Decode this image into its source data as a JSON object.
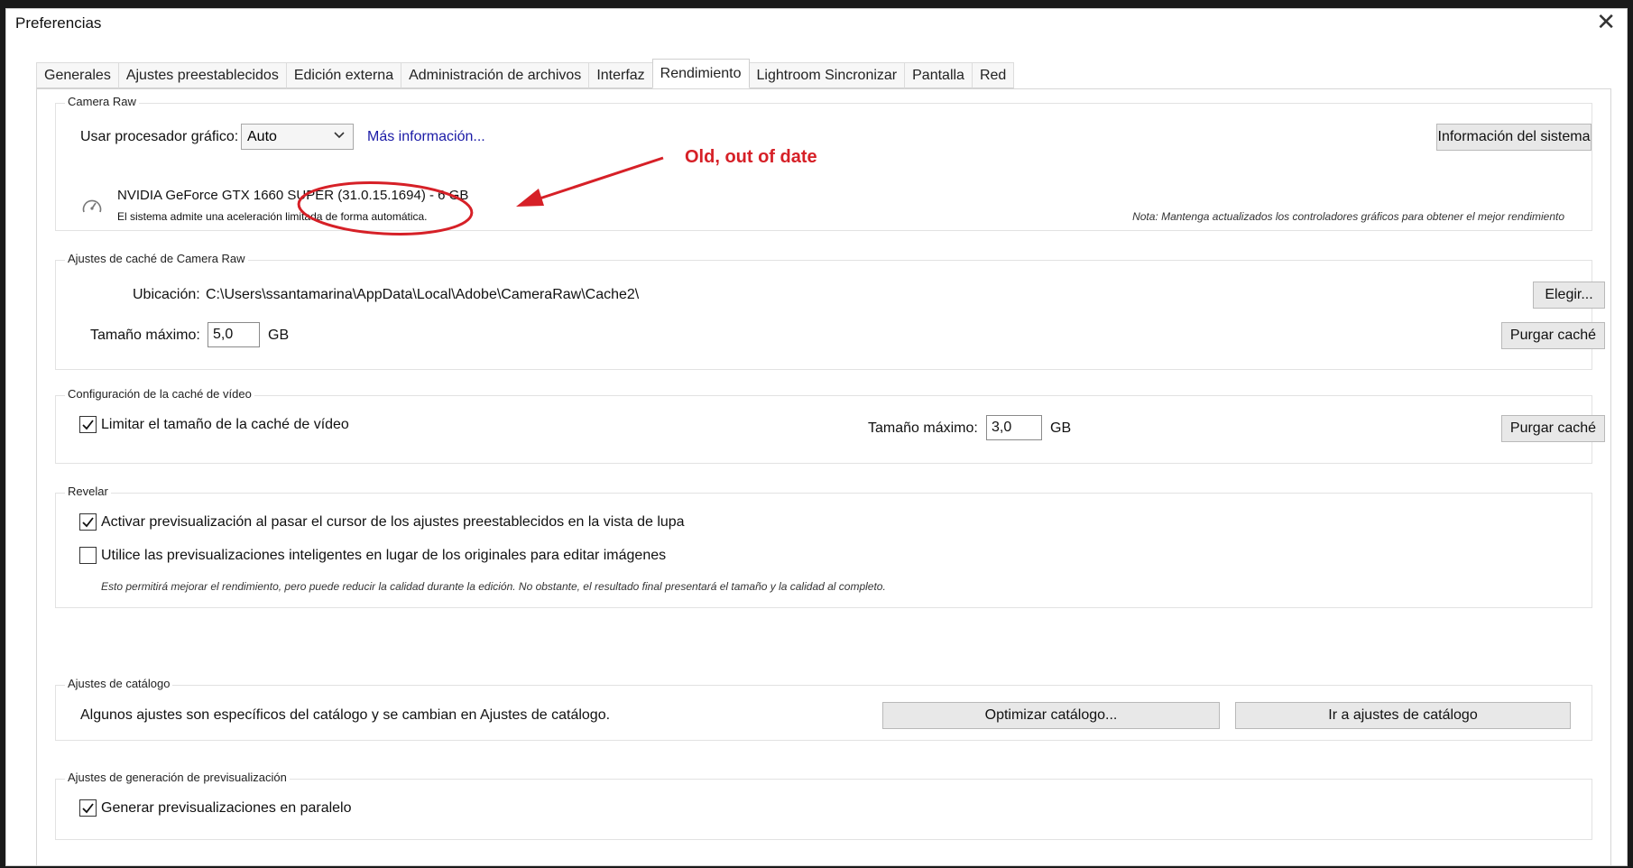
{
  "window": {
    "title": "Preferencias"
  },
  "tabs": [
    {
      "label": "Generales"
    },
    {
      "label": "Ajustes preestablecidos"
    },
    {
      "label": "Edición externa"
    },
    {
      "label": "Administración de archivos"
    },
    {
      "label": "Interfaz"
    },
    {
      "label": "Rendimiento"
    },
    {
      "label": "Lightroom Sincronizar"
    },
    {
      "label": "Pantalla"
    },
    {
      "label": "Red"
    }
  ],
  "active_tab": "Rendimiento",
  "camera_raw": {
    "group_label": "Camera Raw",
    "gpu_label": "Usar procesador gráfico:",
    "gpu_value": "Auto",
    "more_info": "Más información...",
    "system_info_button": "Información del sistema",
    "gpu_name": "NVIDIA GeForce GTX 1660 SUPER (31.0.15.1694) - 6 GB",
    "gpu_support": "El sistema admite una aceleración limitada de forma automática.",
    "note": "Nota: Mantenga actualizados los controladores gráficos para obtener el mejor rendimiento"
  },
  "annotation": {
    "text": "Old, out of date",
    "color": "#d62027"
  },
  "cache": {
    "group_label": "Ajustes de caché de Camera Raw",
    "location_label": "Ubicación:",
    "location_value": "C:\\Users\\ssantamarina\\AppData\\Local\\Adobe\\CameraRaw\\Cache2\\",
    "choose_button": "Elegir...",
    "max_size_label": "Tamaño máximo:",
    "max_size_value": "5,0",
    "unit": "GB",
    "purge_button": "Purgar caché"
  },
  "video_cache": {
    "group_label": "Configuración de la caché de vídeo",
    "limit_label": "Limitar el tamaño de la caché de vídeo",
    "limit_checked": true,
    "max_size_label": "Tamaño máximo:",
    "max_size_value": "3,0",
    "unit": "GB",
    "purge_button": "Purgar caché"
  },
  "develop": {
    "group_label": "Revelar",
    "preview_label": "Activar previsualización al pasar el cursor de los ajustes preestablecidos en la vista de lupa",
    "preview_checked": true,
    "smart_label": "Utilice las previsualizaciones inteligentes en lugar de los originales para editar imágenes",
    "smart_checked": false,
    "smart_note": "Esto permitirá mejorar el rendimiento, pero puede reducir la calidad durante la edición. No obstante, el resultado final presentará el tamaño y la calidad al completo."
  },
  "catalog": {
    "group_label": "Ajustes de catálogo",
    "text": "Algunos ajustes son específicos del catálogo y se cambian en Ajustes de catálogo.",
    "optimize_button": "Optimizar catálogo...",
    "goto_button": "Ir a ajustes de catálogo"
  },
  "preview_gen": {
    "group_label": "Ajustes de generación de previsualización",
    "parallel_label": "Generar previsualizaciones en paralelo",
    "parallel_checked": true
  }
}
